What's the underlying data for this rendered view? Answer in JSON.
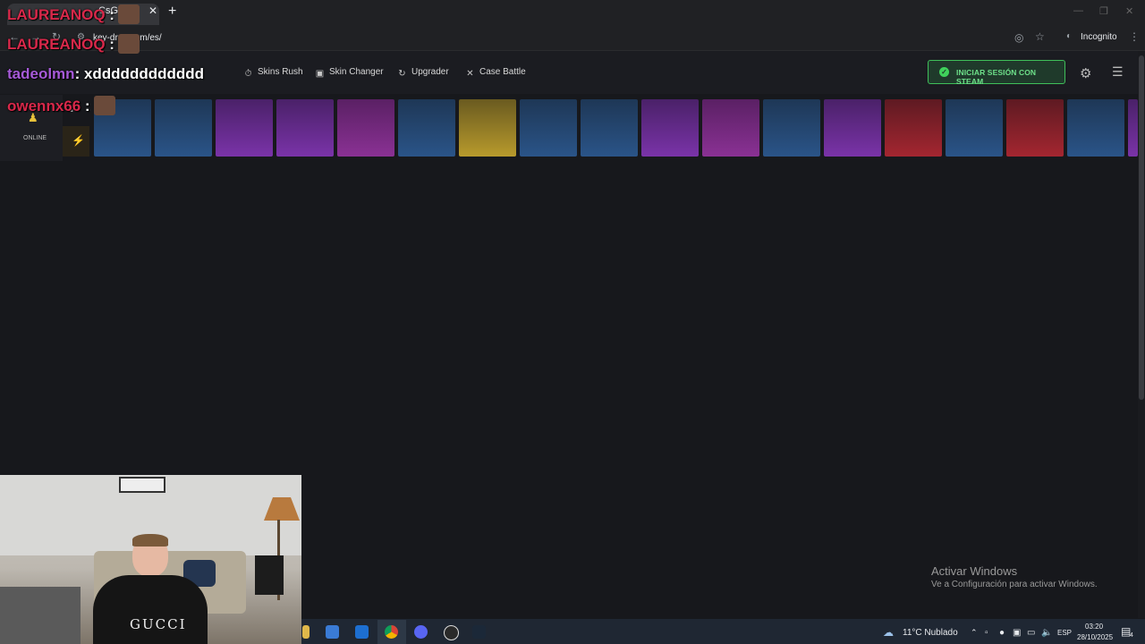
{
  "browser": {
    "tab_title": "CsGo",
    "tab_close": "✕",
    "new_tab": "+",
    "url": "key-drop.com/es/",
    "incognito_label": "Incognito"
  },
  "site": {
    "nav": [
      {
        "label": "Skins Rush",
        "icon": "stopwatch-icon"
      },
      {
        "label": "Skin Changer",
        "icon": "image-icon"
      },
      {
        "label": "Upgrader",
        "icon": "refresh-icon"
      },
      {
        "label": "Case Battle",
        "icon": "swords-icon"
      }
    ],
    "login_label": "INICIAR SESIÓN CON STEAM",
    "online_label": "ONLINE"
  },
  "live_drops": [
    "blue",
    "blue",
    "purple",
    "purple",
    "magenta",
    "blue",
    "gold",
    "blue",
    "blue",
    "purple",
    "magenta",
    "blue",
    "purple",
    "red",
    "blue",
    "red",
    "blue",
    "purple"
  ],
  "chat": [
    {
      "user": "LAUREANOQ",
      "color": "#d8284a",
      "msg": ""
    },
    {
      "user": "LAUREANOQ",
      "color": "#d8284a",
      "msg": ""
    },
    {
      "user": "tadeolmn",
      "color": "#a65ad8",
      "msg": ": xdddddddddddd"
    },
    {
      "user": "owennx66",
      "color": "#d8284a",
      "msg": ""
    }
  ],
  "webcam": {
    "shirt_text": "GUCCI"
  },
  "windows_activation": {
    "title": "Activar Windows",
    "subtitle": "Ve a Configuración para activar Windows."
  },
  "taskbar": {
    "weather": "11°C  Nublado",
    "lang": "ESP",
    "time": "03:20",
    "date": "28/10/2025",
    "notif_count": "4"
  },
  "colors": {
    "login_green": "#3fbf5a",
    "bg": "#17181c"
  }
}
